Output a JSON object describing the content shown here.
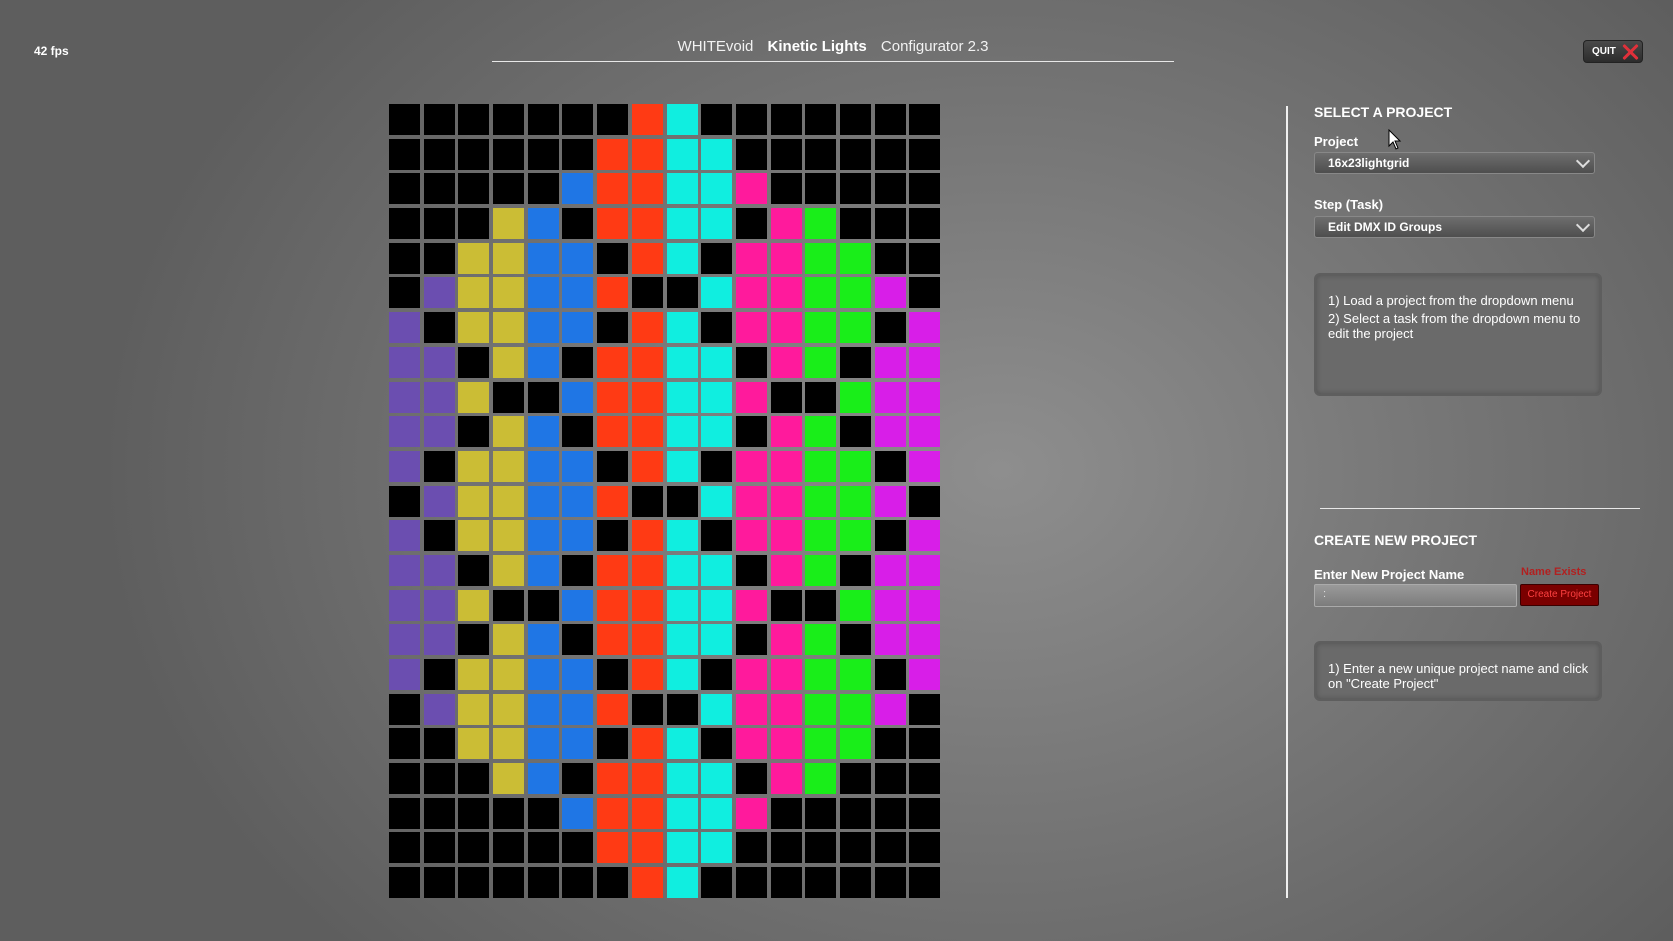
{
  "fps_label": "42 fps",
  "title": {
    "part1": "WHITEvoid",
    "part2": "Kinetic Lights",
    "part3": "Configurator 2.3"
  },
  "quit_label": "QUIT",
  "grid": {
    "cols": 16,
    "rows": 23,
    "palette": {
      "K": "#000000",
      "P": "#6b4eb0",
      "Y": "#cbbd35",
      "B": "#1f76e5",
      "R": "#ff3a14",
      "C": "#10eee0",
      "M": "#ff1a9c",
      "G": "#19ee19",
      "V": "#d81ee8"
    },
    "cells": [
      "KKKKKKKRCKKKKKKK",
      "KKKKKKRRCCKKKKKK",
      "KKKKKBRRCCMKKKKK",
      "KKKYBKRRCCKMGKKK",
      "KKYYBBKRCKMMGGKK",
      "KPYYBBRKKCMMGGVK",
      "PKYYBBKRCKMMGGKV",
      "PPKYBKRRCCKMGKVV",
      "PPYKKBRRCCMKKGVV",
      "PPKYBKRRCCKMGKVV",
      "PKYYBBKRCKMMGGKV",
      "KPYYBBRKKCMMGGVK",
      "PKYYBBKRCKMMGGKV",
      "PPKYBKRRCCKMGKVV",
      "PPYKKBRRCCMKKGVV",
      "PPKYBKRRCCKMGKVV",
      "PKYYBBKRCKMMGGKV",
      "KPYYBBRKKCMMGGVK",
      "KKYYBBKRCKMMGGKK",
      "KKKYBKRRCCKMGKKK",
      "KKKKKBRRCCMKKKKK",
      "KKKKKKRRCCKKKKKK",
      "KKKKKKKRCKKKKKKK"
    ]
  },
  "select_project": {
    "heading": "SELECT A PROJECT",
    "project_label": "Project",
    "project_value": "16x23lightgrid",
    "step_label": "Step (Task)",
    "step_value": "Edit DMX ID Groups",
    "instructions": [
      "1) Load a project from the dropdown menu",
      "2) Select a task from the dropdown menu to edit the project"
    ]
  },
  "create_project": {
    "heading": "CREATE NEW PROJECT",
    "name_label": "Enter New Project Name",
    "name_value": ":",
    "name_exists_label": "Name Exists",
    "create_button_label": "Create Project",
    "instructions": [
      "1) Enter a new unique project name and click on \"Create Project\""
    ]
  }
}
